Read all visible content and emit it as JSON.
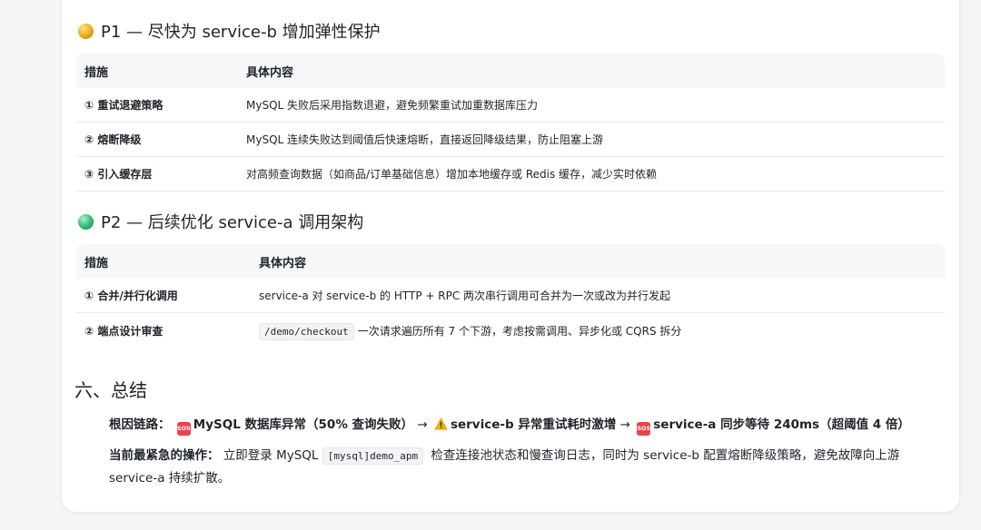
{
  "p1": {
    "title": "P1 — 尽快为 service-b 增加弹性保护",
    "header": [
      "措施",
      "具体内容"
    ],
    "rows": [
      {
        "measure": "① 重试退避策略",
        "content": "MySQL 失败后采用指数退避，避免频繁重试加重数据库压力"
      },
      {
        "measure": "② 熔断降级",
        "content": "MySQL 连续失败达到阈值后快速熔断，直接返回降级结果，防止阻塞上游"
      },
      {
        "measure": "③ 引入缓存层",
        "content": "对高频查询数据（如商品/订单基础信息）增加本地缓存或 Redis 缓存，减少实时依赖"
      }
    ]
  },
  "p2": {
    "title": "P2 — 后续优化 service-a 调用架构",
    "header": [
      "措施",
      "具体内容"
    ],
    "rows": [
      {
        "measure": "① 合并/并行化调用",
        "content": "service-a 对 service-b 的 HTTP + RPC 两次串行调用可合并为一次或改为并行发起"
      },
      {
        "measure": "② 端点设计审查",
        "code": "/demo/checkout",
        "content": "一次请求遍历所有 7 个下游，考虑按需调用、异步化或 CQRS 拆分"
      }
    ]
  },
  "summary": {
    "heading": "六、总结",
    "chain_label": "根因链路：",
    "chain_1": "MySQL 数据库异常（50% 查询失败）",
    "arrow": "→",
    "chain_2": "service-b 异常重试耗时激增",
    "chain_3": "service-a 同步等待 240ms（超阈值 4 倍）",
    "sos_text": "SOS",
    "urgent_label": "当前最紧急的操作：",
    "urgent_pre": "立即登录 MySQL",
    "urgent_code": "[mysql]demo_apm",
    "urgent_post": "检查连接池状态和慢查询日志，同时为 service-b 配置熔断降级策略，避免故障向上游 service-a 持续扩散。"
  },
  "colors": {
    "sos": "#e8434b",
    "warning": "#f5b400",
    "p1_dot": "#e6a417",
    "p2_dot": "#27b36a"
  }
}
